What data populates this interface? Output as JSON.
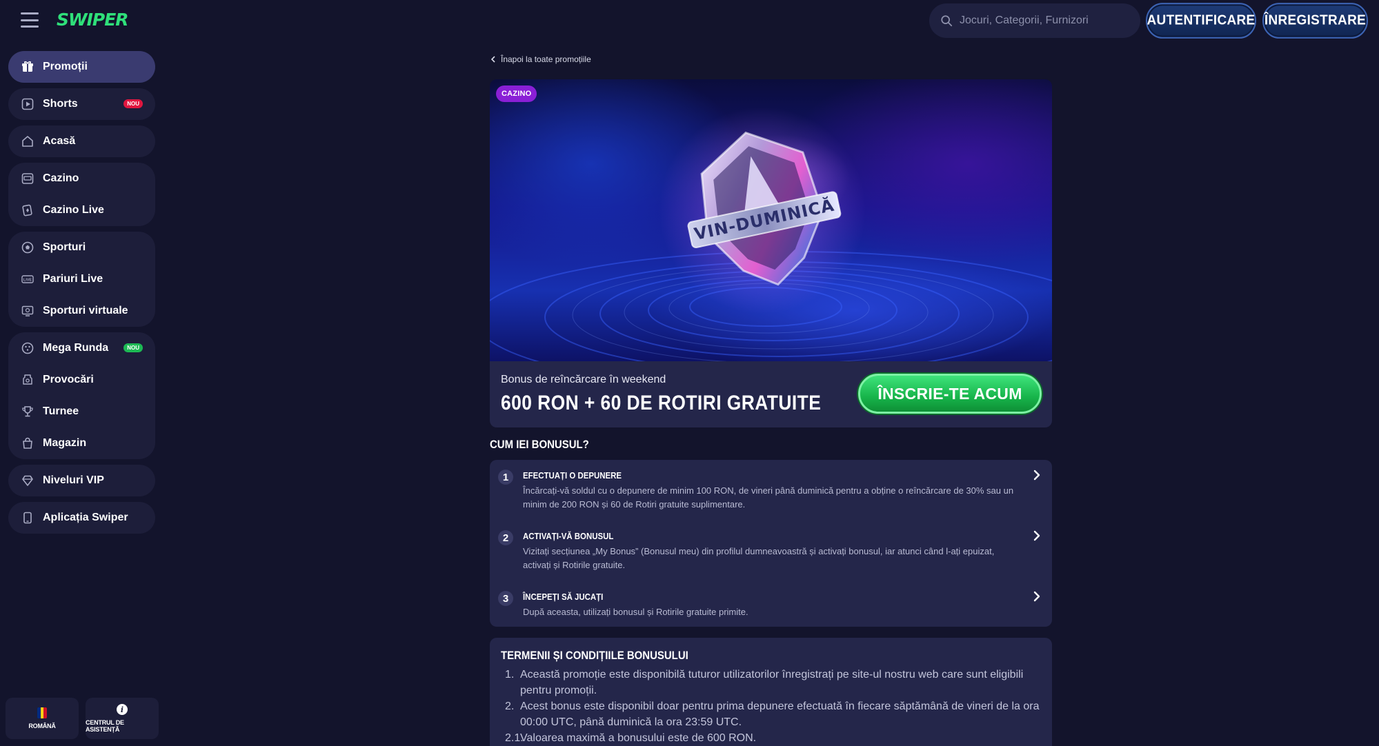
{
  "header": {
    "logo": "SWIPER",
    "search_placeholder": "Jocuri, Categorii, Furnizori",
    "login_label": "AUTENTIFICARE",
    "register_label": "ÎNREGISTRARE"
  },
  "sidebar": {
    "groups": [
      [
        {
          "label": "Promoții",
          "icon": "gift-icon",
          "active": true
        }
      ],
      [
        {
          "label": "Shorts",
          "icon": "play-icon",
          "badge": "NOU"
        }
      ],
      [
        {
          "label": "Acasă",
          "icon": "home-icon"
        }
      ],
      [
        {
          "label": "Cazino",
          "icon": "slot-machine-icon"
        },
        {
          "label": "Cazino Live",
          "icon": "cards-icon"
        }
      ],
      [
        {
          "label": "Sporturi",
          "icon": "soccer-ball-icon"
        },
        {
          "label": "Pariuri Live",
          "icon": "live-icon"
        },
        {
          "label": "Sporturi virtuale",
          "icon": "virtual-sports-icon"
        }
      ],
      [
        {
          "label": "Mega Runda",
          "icon": "dice-icon",
          "badge": "NOU"
        },
        {
          "label": "Provocări",
          "icon": "challenge-icon"
        },
        {
          "label": "Turnee",
          "icon": "trophy-icon"
        },
        {
          "label": "Magazin",
          "icon": "shopping-bag-icon"
        }
      ],
      [
        {
          "label": "Niveluri VIP",
          "icon": "diamond-icon"
        }
      ],
      [
        {
          "label": "Aplicația Swiper",
          "icon": "phone-icon"
        }
      ]
    ],
    "language_label": "ROMÂNĂ",
    "help_label": "CENTRUL DE ASISTENȚĂ"
  },
  "main": {
    "back_link": "Înapoi la toate promoțiile",
    "category_tag": "CAZINO",
    "hero_emblem_text": "VIN-DUMINICĂ",
    "promo_subtitle": "Bonus de reîncărcare în weekend",
    "promo_title": "600 RON + 60 DE ROTIRI GRATUITE",
    "join_button": "ÎNSCRIE-TE ACUM",
    "how_title": "CUM IEI BONUSUL?",
    "steps": [
      {
        "num": "1",
        "title": "EFECTUAȚI O DEPUNERE",
        "text": "Încărcați-vă soldul cu o depunere de minim 100 RON, de vineri până duminică pentru a obține o reîncărcare de 30% sau un minim de 200 RON și 60 de Rotiri gratuite suplimentare."
      },
      {
        "num": "2",
        "title": "ACTIVAȚI-VĂ BONUSUL",
        "text": "Vizitați secțiunea „My Bonus” (Bonusul meu) din profilul dumneavoastră și activați bonusul, iar atunci când l-ați epuizat, activați și Rotirile gratuite."
      },
      {
        "num": "3",
        "title": "ÎNCEPEȚI SĂ JUCAȚI",
        "text": "După aceasta, utilizați bonusul și Rotirile gratuite primite."
      }
    ],
    "terms_title": "TERMENII ȘI CONDIȚIILE BONUSULUI",
    "terms": [
      {
        "n": "1.",
        "text": "Această promoție este disponibilă tuturor utilizatorilor înregistrați pe site-ul nostru web care sunt eligibili pentru promoții."
      },
      {
        "n": "2.",
        "text": "Acest bonus este disponibil doar pentru prima depunere efectuată în fiecare săptămână de vineri de la ora 00:00 UTC, până duminică la ora 23:59 UTC."
      },
      {
        "n": "2.1.",
        "text": "Valoarea maximă a bonusului este de 600 RON."
      }
    ]
  },
  "colors": {
    "background": "#13142c",
    "card": "#24264a",
    "sidebar_card": "#1d1e3a",
    "accent_green": "#1db954",
    "badge_red": "#e0163f",
    "tag_purple": "#8a1fd6"
  }
}
